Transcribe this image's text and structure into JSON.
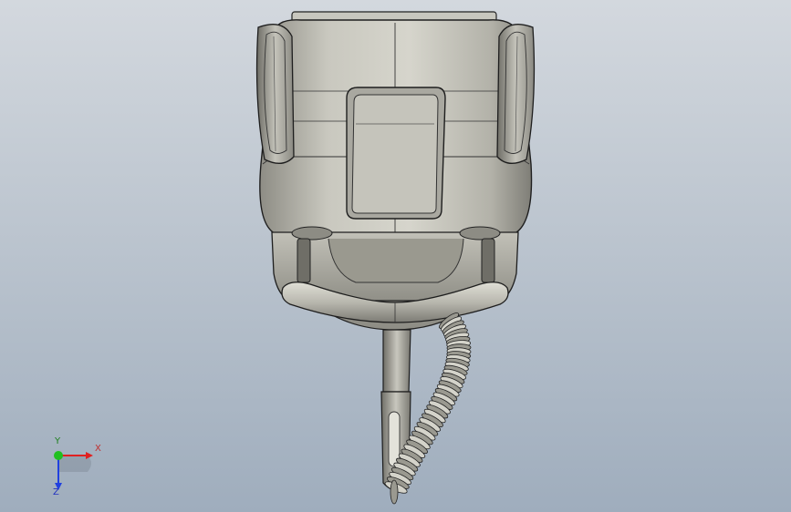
{
  "viewport": {
    "background_top": "#d3d8de",
    "background_bottom": "#9fadbd"
  },
  "model": {
    "subject": "vacuum-cleaner-3d-model",
    "body_color": "#bdbcb3",
    "edge_color": "#1a1a1a"
  },
  "triad": {
    "x_label": "X",
    "y_label": "Y",
    "z_label": "Z",
    "x_color": "#e02020",
    "y_color": "#20c020",
    "z_color": "#2040e0"
  }
}
